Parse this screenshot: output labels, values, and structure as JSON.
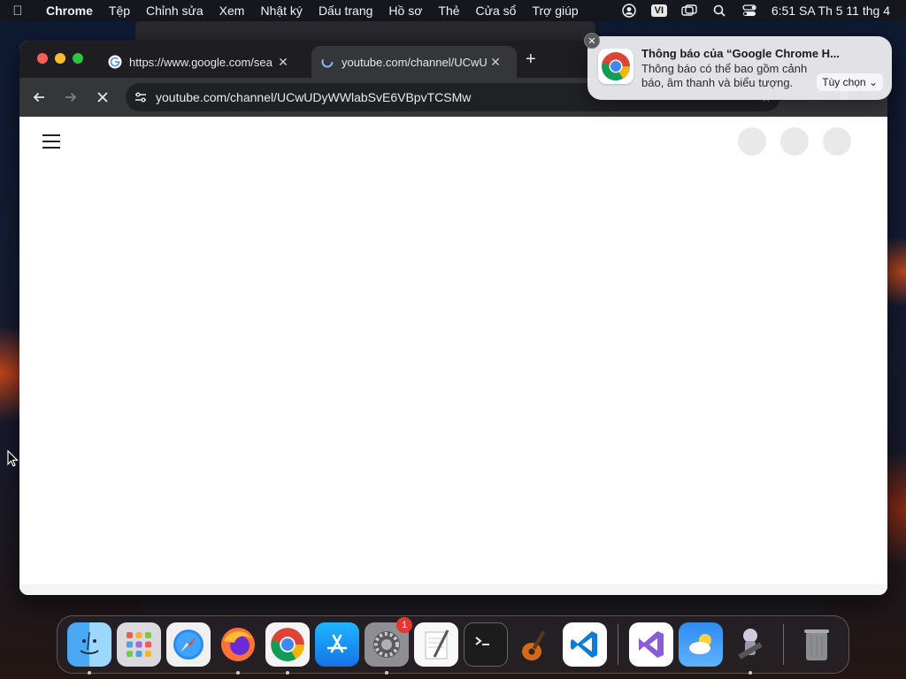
{
  "menubar": {
    "app_name": "Chrome",
    "menus": [
      "Tệp",
      "Chỉnh sửa",
      "Xem",
      "Nhật ký",
      "Dấu trang",
      "Hồ sơ",
      "Thẻ",
      "Cửa sổ",
      "Trợ giúp"
    ],
    "input_source": "VI",
    "clock": "6:51 SA Th 5 11 thg 4"
  },
  "browser": {
    "tabs": [
      {
        "title": "https://www.google.com/sea",
        "favicon": "google-g-icon",
        "active": false
      },
      {
        "title": "youtube.com/channel/UCwU",
        "favicon": "loading-icon",
        "active": true
      }
    ],
    "address_bar": {
      "url": "youtube.com/channel/UCwUDyWWlabSvE6VBpvTCSMw"
    }
  },
  "notification": {
    "title": "Thông báo của “Google Chrome H...",
    "body": "Thông báo có thể bao gồm cảnh báo, âm thanh và biểu tượng.",
    "options_label": "Tùy chọn"
  },
  "dock": {
    "apps": [
      "Finder",
      "Launchpad",
      "Safari",
      "Firefox",
      "Google Chrome",
      "App Store",
      "System Settings",
      "TextEdit",
      "Terminal",
      "GarageBand",
      "Visual Studio Code",
      "Visual Studio",
      "Weather",
      "Automator",
      "Trash"
    ],
    "system_settings_badge": "1"
  },
  "colors": {
    "tabstrip": "#1e1e22",
    "toolbar": "#35363a",
    "omnibox": "#202124",
    "notification_bg": "#e8e8ec"
  }
}
